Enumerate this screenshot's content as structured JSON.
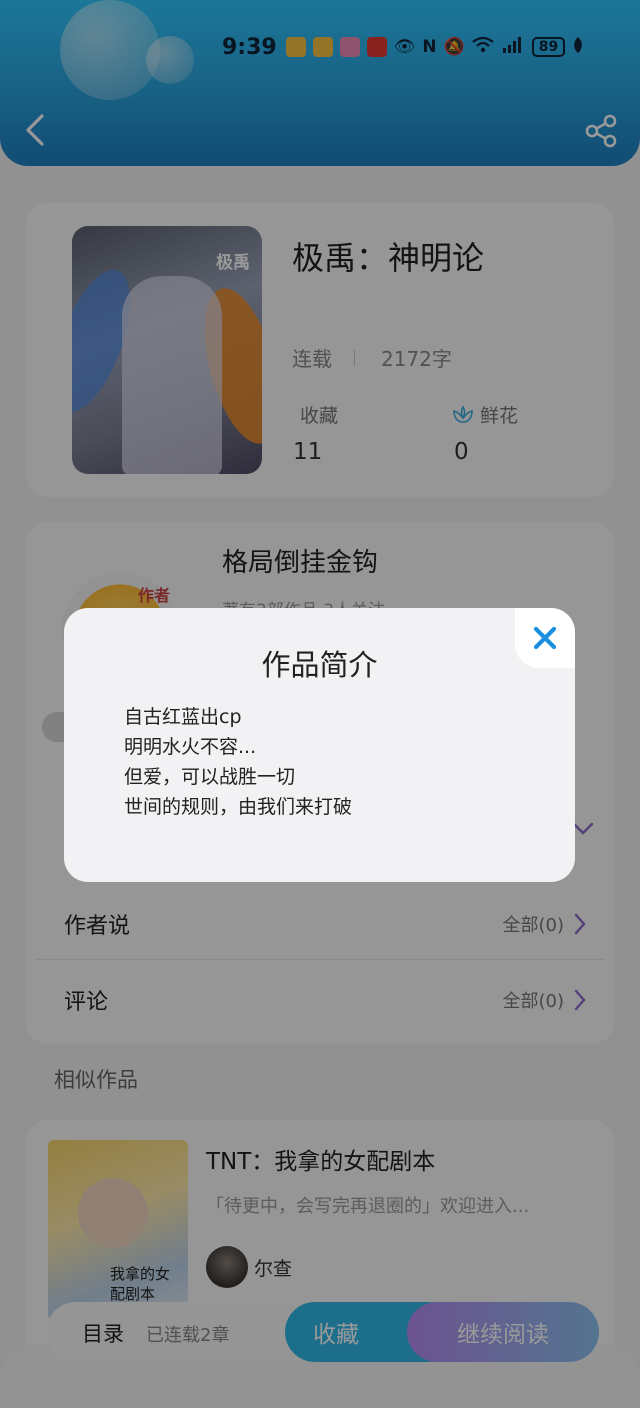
{
  "status_bar": {
    "time": "9:39",
    "battery": "89",
    "icons": [
      "book-app-icon",
      "book-app-icon",
      "video-app-icon",
      "heart-app-icon",
      "eye-icon",
      "nfc-icon",
      "mute-bell-icon",
      "wifi-icon",
      "signal-4g-icon",
      "leaf-icon"
    ]
  },
  "nav": {
    "back_icon": "chevron-left-icon",
    "share_icon": "share-icon"
  },
  "book": {
    "cover_text": "极禹",
    "title": "极禹：神明论",
    "status": "连载",
    "word_count": "2172字",
    "stats": [
      {
        "label": "收藏",
        "value": "11"
      },
      {
        "label": "鲜花",
        "value": "0",
        "icon": "flower-icon"
      }
    ]
  },
  "author": {
    "badge": "作者",
    "name": "格局倒挂金钩",
    "sub": "著有3部作品 3人关注"
  },
  "rows": [
    {
      "label": "作者说",
      "right": "全部(0)"
    },
    {
      "label": "评论",
      "right": "全部(0)"
    }
  ],
  "similar": {
    "heading": "相似作品",
    "items": [
      {
        "title": "TNT：我拿的女配剧本",
        "desc": "「待更中，会写完再退圈的」欢迎进入...",
        "author": "尔查",
        "cover_text": "我拿的女配剧本"
      }
    ]
  },
  "bottom_bar": {
    "toc_label": "目录",
    "toc_sub": "已连载2章",
    "collect_label": "收藏",
    "read_label": "继续阅读"
  },
  "modal": {
    "title": "作品简介",
    "lines": [
      "自古红蓝出cp",
      "明明水火不容...",
      "但爱，可以战胜一切",
      "世间的规则，由我们来打破"
    ]
  },
  "colors": {
    "header_top": "#2fc6ff",
    "header_bottom": "#1e7fc0",
    "accent_blue": "#2fb7e8",
    "accent_purple": "#b58bf2",
    "close_icon": "#1a8fe0"
  }
}
